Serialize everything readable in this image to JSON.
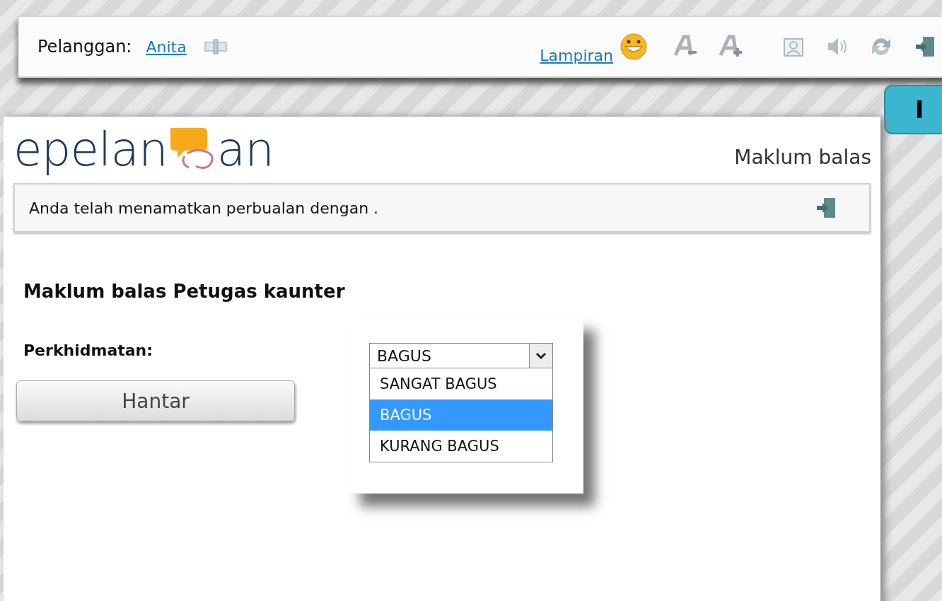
{
  "toolbar": {
    "label": "Pelanggan:",
    "customer": "Anita",
    "attachment_link": "Lampiran"
  },
  "callout": {
    "text": "I"
  },
  "logo": {
    "text_left": "epelan",
    "text_right": "an"
  },
  "page_title": "Maklum balas",
  "notice": "Anda telah menamatkan perbualan dengan .",
  "section_title": "Maklum balas Petugas kaunter",
  "field": {
    "label": "Perkhidmatan:",
    "value": "BAGUS",
    "expanded": true,
    "options": [
      {
        "label": "SANGAT BAGUS",
        "selected": false
      },
      {
        "label": "BAGUS",
        "selected": true
      },
      {
        "label": "KURANG BAGUS",
        "selected": false
      }
    ]
  },
  "submit_button": "Hantar"
}
